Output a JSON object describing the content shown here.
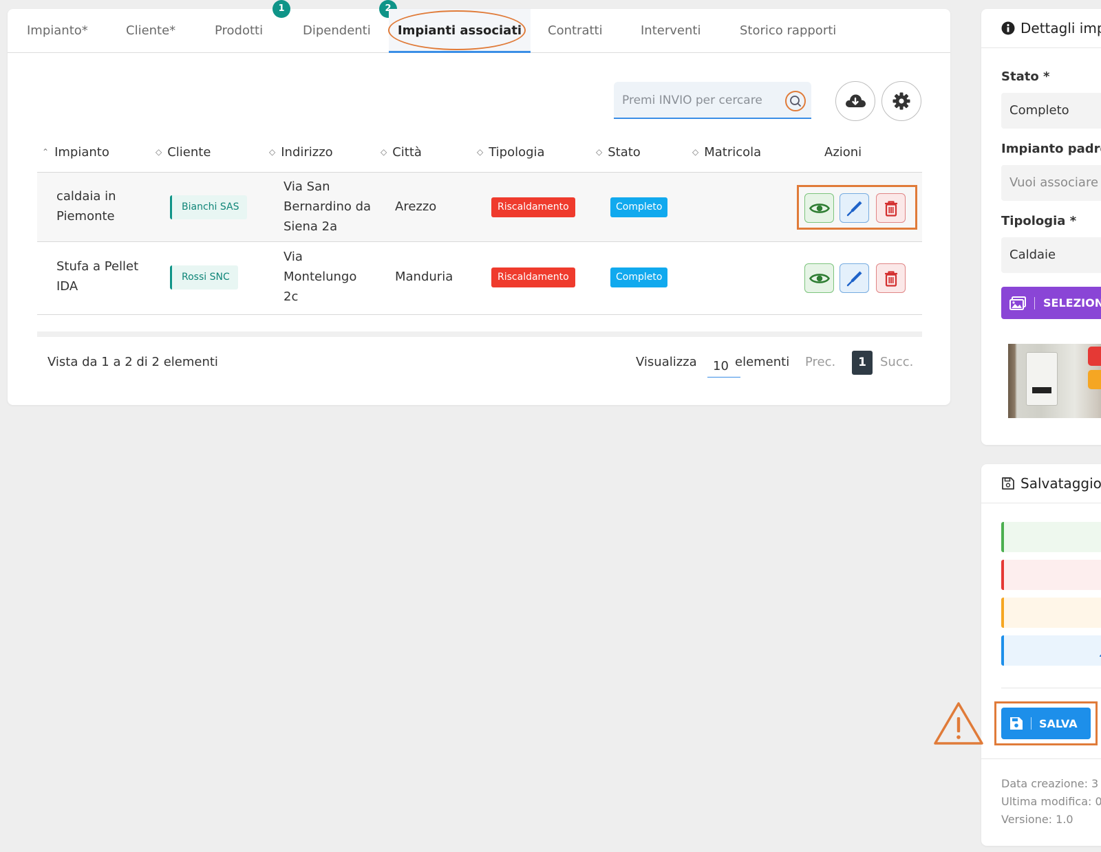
{
  "tabs": [
    {
      "label": "Impianto*",
      "badge": ""
    },
    {
      "label": "Cliente*",
      "badge": ""
    },
    {
      "label": "Prodotti",
      "badge": "1"
    },
    {
      "label": "Dipendenti",
      "badge": "2"
    },
    {
      "label": "Impianti associati",
      "badge": "",
      "active": true
    },
    {
      "label": "Contratti",
      "badge": ""
    },
    {
      "label": "Interventi",
      "badge": ""
    },
    {
      "label": "Storico rapporti",
      "badge": ""
    }
  ],
  "search": {
    "placeholder": "Premi INVIO per cercare"
  },
  "table": {
    "columns": [
      "Impianto",
      "Cliente",
      "Indirizzo",
      "Città",
      "Tipologia",
      "Stato",
      "Matricola",
      "Azioni"
    ],
    "rows": [
      {
        "impianto": "caldaia in Piemonte",
        "cliente": "Bianchi SAS",
        "indirizzo": "Via San Bernardino da Siena 2a",
        "citta": "Arezzo",
        "tipologia": "Riscaldamento",
        "stato": "Completo",
        "matricola": ""
      },
      {
        "impianto": "Stufa a Pellet IDA",
        "cliente": "Rossi SNC",
        "indirizzo": "Via Montelungo 2c",
        "citta": "Manduria",
        "tipologia": "Riscaldamento",
        "stato": "Completo",
        "matricola": ""
      }
    ]
  },
  "footer": {
    "summary": "Vista da 1 a 2 di 2 elementi",
    "show_label": "Visualizza",
    "page_size": "10",
    "items_label": "elementi",
    "prev": "Prec.",
    "page": "1",
    "next": "Succ."
  },
  "details": {
    "title": "Dettagli imp",
    "stato_label": "Stato *",
    "stato_value": "Completo",
    "padre_label": "Impianto padre",
    "padre_placeholder": "Vuoi associare",
    "tipologia_label": "Tipologia *",
    "tipologia_value": "Caldaie",
    "select_label": "SELEZIONA"
  },
  "save_panel": {
    "title": "Salvataggio",
    "save_label": "SALVA",
    "created": "Data creazione: 3",
    "modified": "Ultima modifica: 0",
    "version": "Versione: 1.0"
  },
  "colors": {
    "accent": "#3a8ee6",
    "highlight": "#e07b39",
    "badge_teal": "#0f9488",
    "danger": "#ef3b2d",
    "info": "#11a9ee",
    "purple": "#8a45d6",
    "save_blue": "#1d8fea"
  }
}
